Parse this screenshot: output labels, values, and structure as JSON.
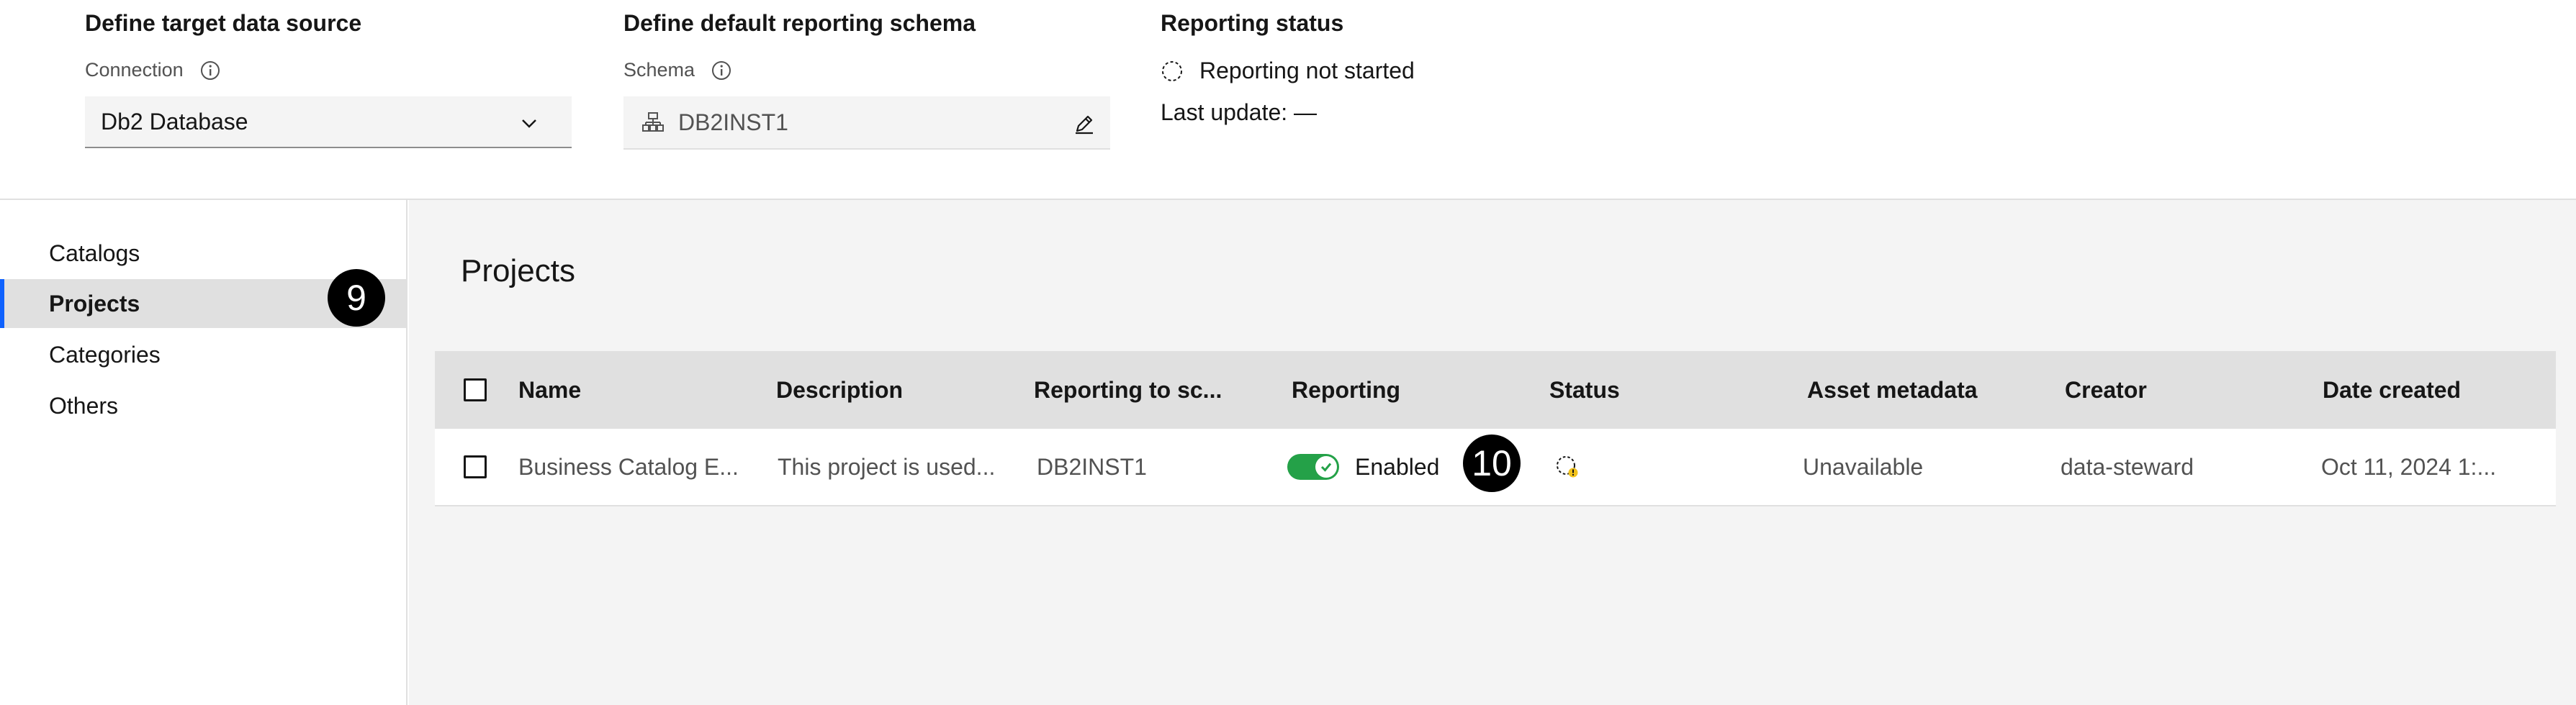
{
  "target_source": {
    "title": "Define target data source",
    "label": "Connection",
    "selected": "Db2 Database"
  },
  "schema": {
    "title": "Define default reporting schema",
    "label": "Schema",
    "value": "DB2INST1"
  },
  "reporting_status": {
    "title": "Reporting status",
    "status": "Reporting not started",
    "last_update": "Last update: —"
  },
  "sidebar": {
    "items": [
      {
        "label": "Catalogs"
      },
      {
        "label": "Projects"
      },
      {
        "label": "Categories"
      },
      {
        "label": "Others"
      }
    ]
  },
  "main": {
    "title": "Projects",
    "columns": [
      "Name",
      "Description",
      "Reporting to sc...",
      "Reporting",
      "Status",
      "Asset metadata",
      "Creator",
      "Date created"
    ],
    "rows": [
      {
        "name": "Business Catalog E...",
        "description": "This project is used...",
        "reporting_to": "DB2INST1",
        "reporting": "Enabled",
        "asset_metadata": "Unavailable",
        "creator": "data-steward",
        "date_created": "Oct 11, 2024 1:..."
      }
    ]
  },
  "annotations": {
    "badge_9": "9",
    "badge_10": "10"
  },
  "colors": {
    "accent": "#0f62fe",
    "toggle_on": "#24a148",
    "status_warning": "#f1c21b"
  }
}
